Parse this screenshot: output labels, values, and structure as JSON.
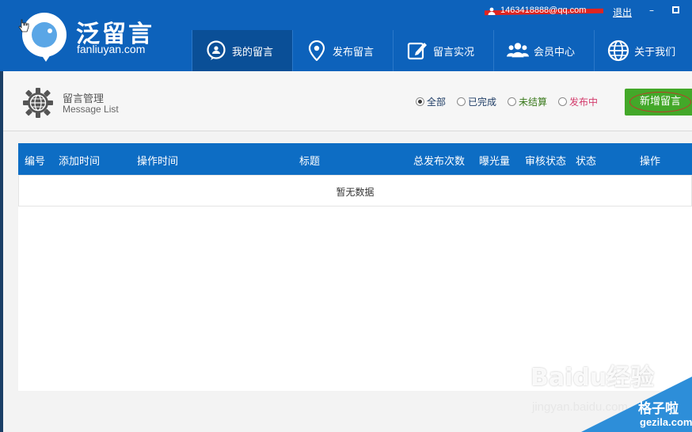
{
  "brand": {
    "name_cn": "泛留言",
    "domain": "fanliuyan.com"
  },
  "topbar": {
    "account": "1463418888@qq.com",
    "logout": "退出",
    "minimize": "–"
  },
  "nav": [
    {
      "label": "我的留言",
      "icon": "chat-bubble-icon",
      "active": true
    },
    {
      "label": "发布留言",
      "icon": "location-pin-icon",
      "active": false
    },
    {
      "label": "留言实况",
      "icon": "edit-icon",
      "active": false
    },
    {
      "label": "会员中心",
      "icon": "members-icon",
      "active": false
    },
    {
      "label": "关于我们",
      "icon": "globe-icon",
      "active": false
    }
  ],
  "page": {
    "title": "留言管理",
    "subtitle": "Message List"
  },
  "filters": [
    {
      "label": "全部",
      "selected": true,
      "color": "#1f3d66"
    },
    {
      "label": "已完成",
      "selected": false,
      "color": "#1f3d66"
    },
    {
      "label": "未结算",
      "selected": false,
      "color": "#3a7a1c"
    },
    {
      "label": "发布中",
      "selected": false,
      "color": "#d33a6b"
    }
  ],
  "new_button": {
    "label": "新增留言"
  },
  "table": {
    "columns": [
      "编号",
      "添加时间",
      "操作时间",
      "标题",
      "总发布次数",
      "曝光量",
      "审核状态",
      "状态",
      "操作"
    ],
    "empty_text": "暂无数据"
  },
  "watermark": {
    "brand": "Baidu经验",
    "url": "jingyan.baidu.com",
    "corner_cn": "格子啦",
    "corner_en": "gezila.com"
  },
  "colors": {
    "header": "#0d62bb",
    "table_header": "#0d6dc4",
    "button": "#43a829"
  }
}
